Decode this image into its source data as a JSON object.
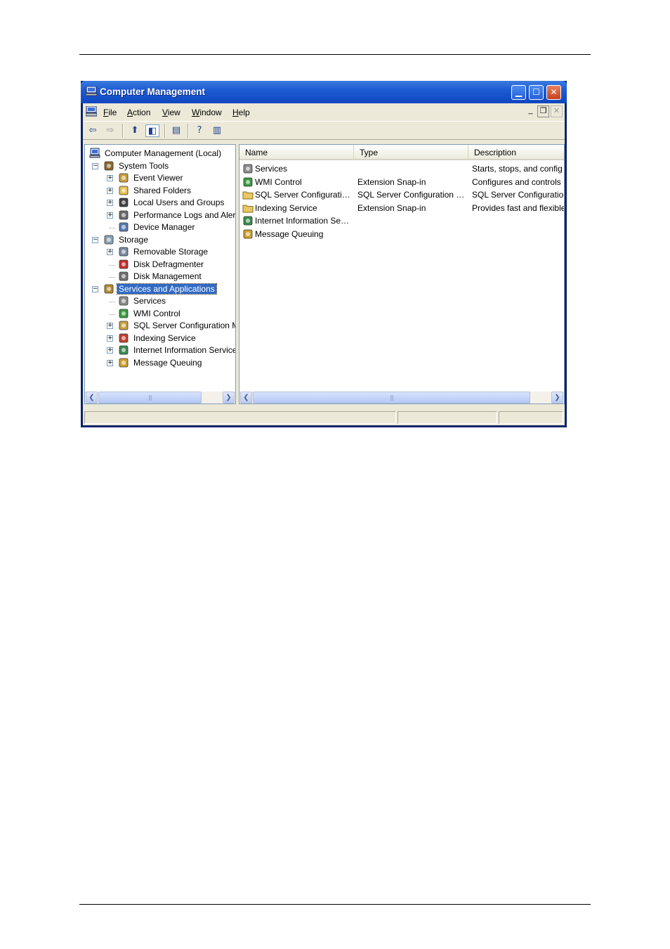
{
  "window": {
    "title": "Computer Management",
    "controls": {
      "minimize": "minimize-icon",
      "maximize": "maximize-icon",
      "close": "close-icon"
    }
  },
  "menubar": {
    "items": [
      {
        "label": "File",
        "accel": "F"
      },
      {
        "label": "Action",
        "accel": "A"
      },
      {
        "label": "View",
        "accel": "V"
      },
      {
        "label": "Window",
        "accel": "W"
      },
      {
        "label": "Help",
        "accel": "H"
      }
    ]
  },
  "toolbar": {
    "buttons": [
      "back-icon",
      "forward-icon",
      "up-folder-icon",
      "show-hide-tree-icon",
      "export-list-icon",
      "help-icon",
      "show-hide-action-pane-icon"
    ]
  },
  "tree": {
    "items": [
      {
        "label": "Computer Management (Local)",
        "level": 0,
        "expander": "",
        "icon": "computer-icon"
      },
      {
        "label": "System Tools",
        "level": 1,
        "expander": "−",
        "icon": "system-tools-icon"
      },
      {
        "label": "Event Viewer",
        "level": 2,
        "expander": "+",
        "icon": "event-viewer-icon"
      },
      {
        "label": "Shared Folders",
        "level": 2,
        "expander": "+",
        "icon": "shared-folders-icon"
      },
      {
        "label": "Local Users and Groups",
        "level": 2,
        "expander": "+",
        "icon": "users-icon"
      },
      {
        "label": "Performance Logs and Alerts",
        "level": 2,
        "expander": "+",
        "icon": "performance-icon"
      },
      {
        "label": "Device Manager",
        "level": 2,
        "expander": "",
        "icon": "device-manager-icon"
      },
      {
        "label": "Storage",
        "level": 1,
        "expander": "−",
        "icon": "storage-icon"
      },
      {
        "label": "Removable Storage",
        "level": 2,
        "expander": "+",
        "icon": "removable-storage-icon"
      },
      {
        "label": "Disk Defragmenter",
        "level": 2,
        "expander": "",
        "icon": "defragmenter-icon"
      },
      {
        "label": "Disk Management",
        "level": 2,
        "expander": "",
        "icon": "disk-management-icon"
      },
      {
        "label": "Services and Applications",
        "level": 1,
        "expander": "−",
        "icon": "services-apps-icon",
        "selected": true
      },
      {
        "label": "Services",
        "level": 2,
        "expander": "",
        "icon": "services-icon"
      },
      {
        "label": "WMI Control",
        "level": 2,
        "expander": "",
        "icon": "wmi-icon"
      },
      {
        "label": "SQL Server Configuration Manager",
        "level": 2,
        "expander": "+",
        "icon": "sql-server-icon"
      },
      {
        "label": "Indexing Service",
        "level": 2,
        "expander": "+",
        "icon": "indexing-icon"
      },
      {
        "label": "Internet Information Services",
        "level": 2,
        "expander": "+",
        "icon": "iis-icon"
      },
      {
        "label": "Message Queuing",
        "level": 2,
        "expander": "+",
        "icon": "message-queuing-icon"
      }
    ]
  },
  "list": {
    "columns": [
      "Name",
      "Type",
      "Description"
    ],
    "rows": [
      {
        "name": "Services",
        "type": "",
        "description": "Starts, stops, and config",
        "icon": "services-icon"
      },
      {
        "name": "WMI Control",
        "type": "Extension Snap-in",
        "description": "Configures and controls",
        "icon": "wmi-icon"
      },
      {
        "name": "SQL Server Configurati…",
        "type": "SQL Server Configuration …",
        "description": "SQL Server Configuratio",
        "icon": "folder-icon"
      },
      {
        "name": "Indexing Service",
        "type": "Extension Snap-in",
        "description": "Provides fast and flexible",
        "icon": "folder-icon"
      },
      {
        "name": "Internet Information Se…",
        "type": "",
        "description": "",
        "icon": "iis-icon"
      },
      {
        "name": "Message Queuing",
        "type": "",
        "description": "",
        "icon": "message-queuing-icon"
      }
    ]
  },
  "colors": {
    "titlebar": "#0f47c0",
    "selection": "#316ac5",
    "window_face": "#ece9d8"
  }
}
